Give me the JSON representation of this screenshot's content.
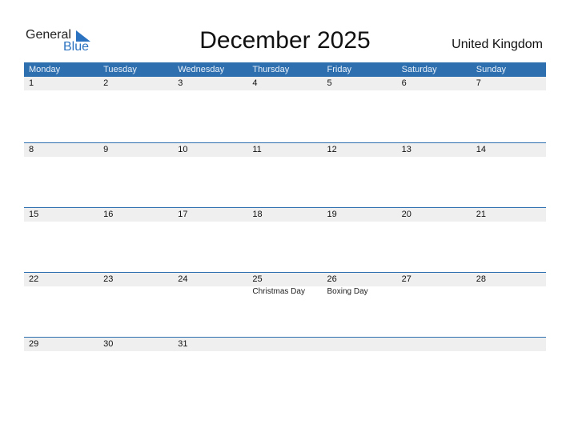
{
  "logo": {
    "line1": "General",
    "line2": "Blue"
  },
  "title": "December 2025",
  "country": "United Kingdom",
  "colors": {
    "header": "#2e6fb0",
    "band": "#efefef",
    "brand": "#2b72c0"
  },
  "weekdays": [
    "Monday",
    "Tuesday",
    "Wednesday",
    "Thursday",
    "Friday",
    "Saturday",
    "Sunday"
  ],
  "weeks": [
    {
      "days": [
        "1",
        "2",
        "3",
        "4",
        "5",
        "6",
        "7"
      ],
      "holidays": [
        "",
        "",
        "",
        "",
        "",
        "",
        ""
      ]
    },
    {
      "days": [
        "8",
        "9",
        "10",
        "11",
        "12",
        "13",
        "14"
      ],
      "holidays": [
        "",
        "",
        "",
        "",
        "",
        "",
        ""
      ]
    },
    {
      "days": [
        "15",
        "16",
        "17",
        "18",
        "19",
        "20",
        "21"
      ],
      "holidays": [
        "",
        "",
        "",
        "",
        "",
        "",
        ""
      ]
    },
    {
      "days": [
        "22",
        "23",
        "24",
        "25",
        "26",
        "27",
        "28"
      ],
      "holidays": [
        "",
        "",
        "",
        "Christmas Day",
        "Boxing Day",
        "",
        ""
      ]
    },
    {
      "days": [
        "29",
        "30",
        "31",
        "",
        "",
        "",
        ""
      ],
      "holidays": [
        "",
        "",
        "",
        "",
        "",
        "",
        ""
      ]
    }
  ]
}
